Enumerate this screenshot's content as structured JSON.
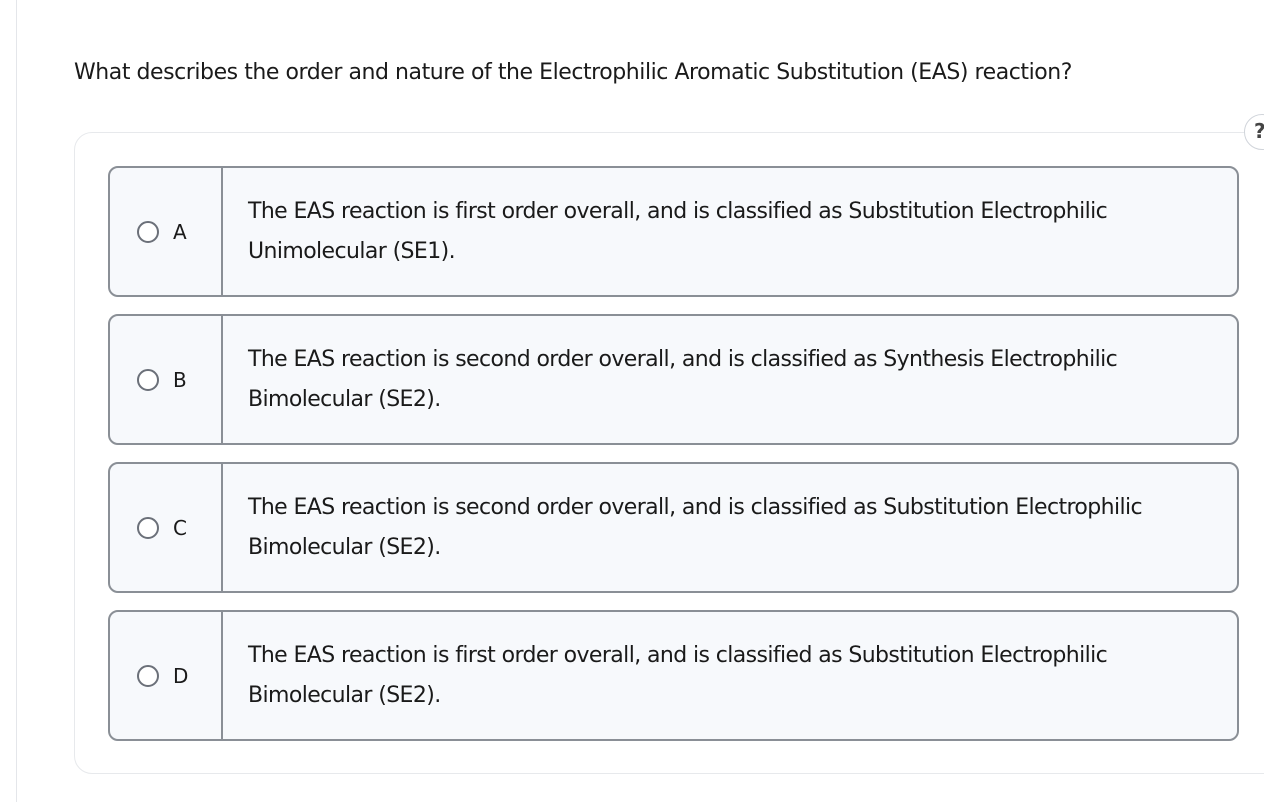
{
  "question": {
    "text": "What describes the order and nature of the Electrophilic Aromatic Substitution (EAS) reaction?"
  },
  "help": {
    "label": "?"
  },
  "options": [
    {
      "letter": "A",
      "text": "The EAS reaction is first order overall, and is classified as Substitution Electrophilic Unimolecular (SE1)."
    },
    {
      "letter": "B",
      "text": "The EAS reaction is second order overall, and is classified as Synthesis Electrophilic Bimolecular (SE2)."
    },
    {
      "letter": "C",
      "text": "The EAS reaction is second order overall, and is classified as Substitution Electrophilic Bimolecular (SE2)."
    },
    {
      "letter": "D",
      "text": "The EAS reaction is first order overall, and is classified as Substitution Electrophilic Bimolecular (SE2)."
    }
  ],
  "colors": {
    "option_border": "#8a8f96",
    "option_background": "#f7f9fc",
    "panel_border": "#e7e9ec"
  }
}
